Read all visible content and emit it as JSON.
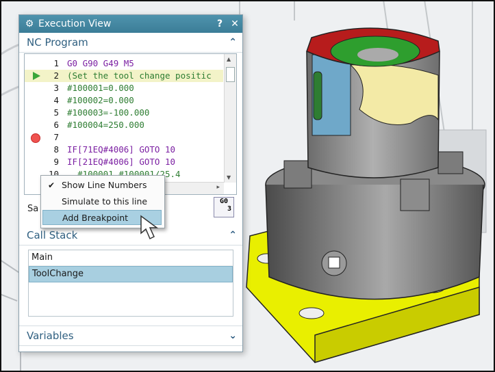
{
  "panel": {
    "title": "Execution View",
    "help_icon": "?",
    "close_icon": "✕"
  },
  "nc_program": {
    "header": "NC Program",
    "lines": [
      {
        "n": "1",
        "text": "G0 G90 G49 M5"
      },
      {
        "n": "2",
        "text": "(Set the tool change positic"
      },
      {
        "n": "3",
        "text": "#100001=0.000"
      },
      {
        "n": "4",
        "text": "#100002=0.000"
      },
      {
        "n": "5",
        "text": "#100003=-100.000"
      },
      {
        "n": "6",
        "text": "#100004=250.000"
      },
      {
        "n": "7",
        "text": ""
      },
      {
        "n": "8",
        "text": "IF[71EQ#4006] GOTO 10"
      },
      {
        "n": "9",
        "text": "IF[21EQ#4006] GOTO 10"
      },
      {
        "n": "10",
        "text": "  #100001 #100001/25.4"
      }
    ],
    "sat_label": "Sa",
    "g0_button": {
      "line1": "G0",
      "line2": "3"
    }
  },
  "context_menu": {
    "items": [
      {
        "label": "Show Line Numbers",
        "checked": true
      },
      {
        "label": "Simulate to this line",
        "checked": false
      },
      {
        "label": "Add Breakpoint",
        "checked": false
      }
    ]
  },
  "call_stack": {
    "header": "Call Stack",
    "items": [
      "Main",
      "ToolChange"
    ],
    "selected": "ToolChange"
  },
  "variables": {
    "header": "Variables"
  },
  "colors": {
    "title_bar": "#3b7d97",
    "selection": "#a8cfe0",
    "fixture_yellow": "#f0f000",
    "workpiece_red": "#b71c1c",
    "workpiece_green": "#2e9e2e"
  }
}
